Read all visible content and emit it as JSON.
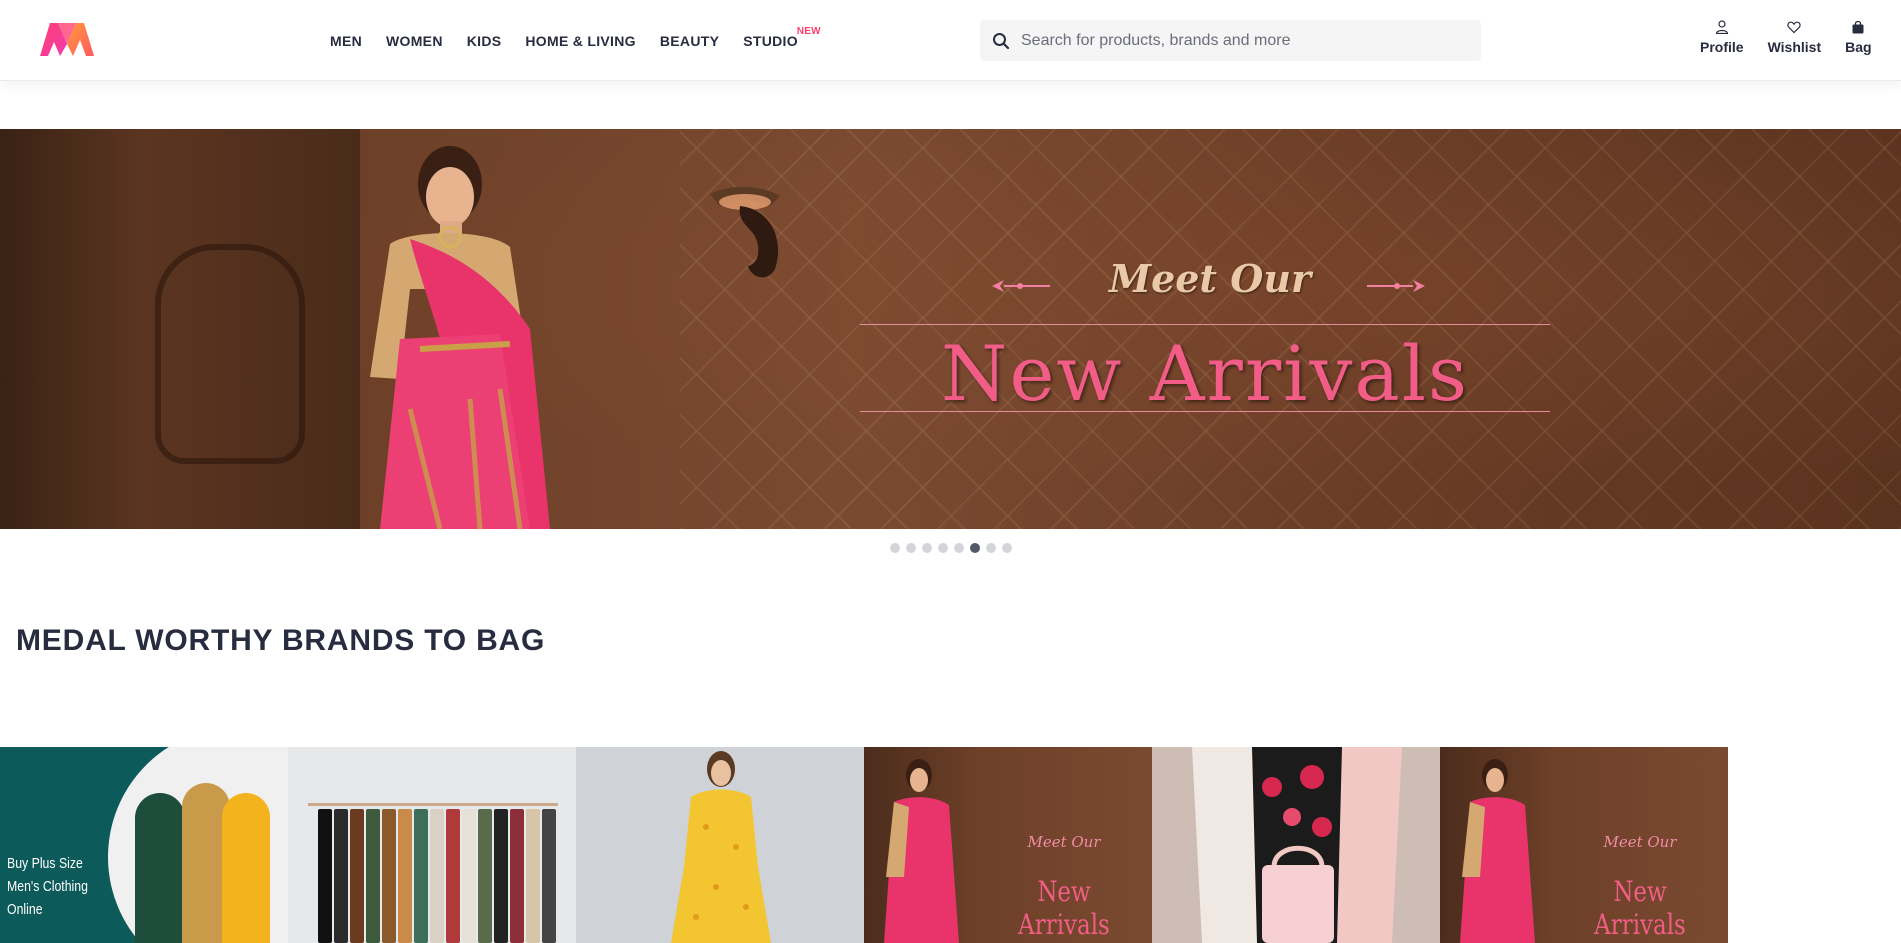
{
  "header": {
    "nav": [
      "Men",
      "Women",
      "Kids",
      "Home & Living",
      "Beauty",
      "Studio"
    ],
    "studio_badge": "NEW",
    "search_placeholder": "Search for products, brands and more",
    "actions": {
      "profile": "Profile",
      "wishlist": "Wishlist",
      "bag": "Bag"
    }
  },
  "hero": {
    "title_small": "Meet Our",
    "title_big": "New Arrivals",
    "carousel": {
      "total_slides": 8,
      "active_slide": 6
    }
  },
  "section": {
    "heading": "Medal Worthy Brands To Bag"
  },
  "tiles": {
    "plus_size_caption": "Buy Plus Size Men's Clothing Online",
    "promo_small": "Meet Our",
    "promo_big": "New Arrivals"
  },
  "colors": {
    "brand_pink": "#ff3f6c",
    "text": "#282c3f",
    "search_bg": "#f5f5f6"
  }
}
